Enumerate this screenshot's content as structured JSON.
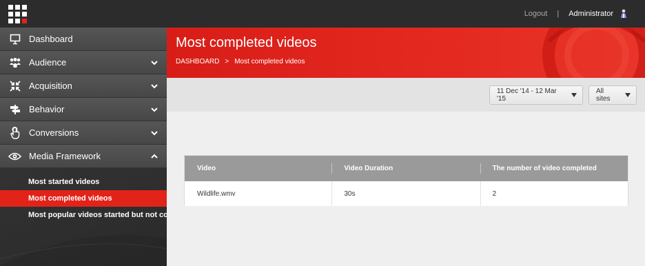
{
  "topbar": {
    "logout_label": "Logout",
    "separator": "|",
    "user_label": "Administrator"
  },
  "sidebar": {
    "items": [
      {
        "label": "Dashboard",
        "icon": "monitor-icon",
        "has_chevron": false
      },
      {
        "label": "Audience",
        "icon": "users-icon",
        "has_chevron": true,
        "chevron": "down"
      },
      {
        "label": "Acquisition",
        "icon": "arrows-inward-icon",
        "has_chevron": true,
        "chevron": "down"
      },
      {
        "label": "Behavior",
        "icon": "signpost-icon",
        "has_chevron": true,
        "chevron": "down"
      },
      {
        "label": "Conversions",
        "icon": "pointer-hand-icon",
        "has_chevron": true,
        "chevron": "down"
      },
      {
        "label": "Media Framework",
        "icon": "eye-icon",
        "has_chevron": true,
        "chevron": "up",
        "expanded": true
      }
    ],
    "submenu": [
      {
        "label": "Most started videos",
        "active": false
      },
      {
        "label": "Most completed videos",
        "active": true
      },
      {
        "label": "Most popular videos started but not com...",
        "active": false
      }
    ]
  },
  "header": {
    "title": "Most completed videos",
    "breadcrumb": [
      "DASHBOARD",
      ">",
      "Most completed videos"
    ]
  },
  "filters": {
    "date_range": "11 Dec '14 - 12 Mar '15",
    "site": "All sites"
  },
  "table": {
    "columns": [
      "Video",
      "Video Duration",
      "The number of video completed"
    ],
    "rows": [
      [
        "Wildlife.wmv",
        "30s",
        "2"
      ]
    ]
  },
  "colors": {
    "accent_red": "#e2231a",
    "topbar_bg": "#2c2c2c",
    "table_header_bg": "#9a9a9a"
  }
}
